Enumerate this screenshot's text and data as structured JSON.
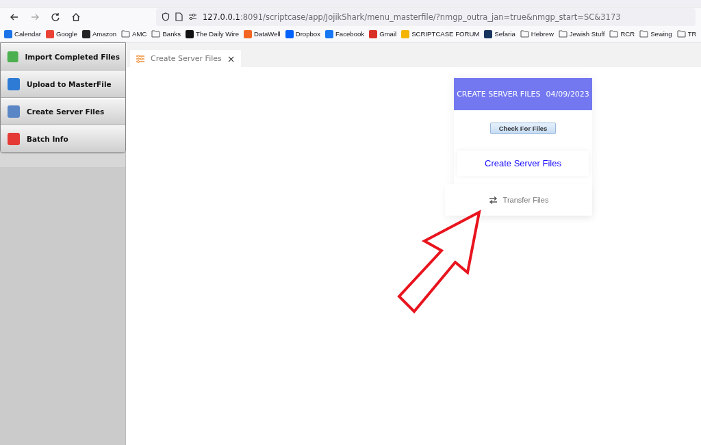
{
  "browser": {
    "url_host": "127.0.0.1",
    "url_rest": ":8091/scriptcase/app/JojikShark/menu_masterfile/?nmgp_outra_jan=true&nmgp_start=SC&3173",
    "bookmarks": [
      {
        "label": "Calendar",
        "kind": "site",
        "color": "#1a73e8"
      },
      {
        "label": "Google",
        "kind": "site",
        "color": "#ea4335"
      },
      {
        "label": "Amazon",
        "kind": "site",
        "color": "#222222"
      },
      {
        "label": "AMC",
        "kind": "folder"
      },
      {
        "label": "Banks",
        "kind": "folder"
      },
      {
        "label": "The Daily Wire",
        "kind": "site",
        "color": "#111111"
      },
      {
        "label": "DataWell",
        "kind": "site",
        "color": "#f26522"
      },
      {
        "label": "Dropbox",
        "kind": "site",
        "color": "#0061fe"
      },
      {
        "label": "Facebook",
        "kind": "site",
        "color": "#1877f2"
      },
      {
        "label": "Gmail",
        "kind": "site",
        "color": "#d93025"
      },
      {
        "label": "SCRIPTCASE FORUM",
        "kind": "site",
        "color": "#f4b400"
      },
      {
        "label": "Sefaria",
        "kind": "site",
        "color": "#18345d"
      },
      {
        "label": "Hebrew",
        "kind": "folder"
      },
      {
        "label": "Jewish Stuff",
        "kind": "folder"
      },
      {
        "label": "RCR",
        "kind": "folder"
      },
      {
        "label": "Sewing",
        "kind": "folder"
      },
      {
        "label": "TR",
        "kind": "folder"
      }
    ]
  },
  "menu": [
    {
      "label": "Import Completed Files",
      "color": "#4caf50"
    },
    {
      "label": "Upload to MasterFile",
      "color": "#2e7bd6"
    },
    {
      "label": "Create Server Files",
      "color": "#5b86c5"
    },
    {
      "label": "Batch Info",
      "color": "#e53935"
    }
  ],
  "tab": {
    "label": "Create Server Files",
    "close": "×"
  },
  "card": {
    "title": "CREATE SERVER FILES",
    "date": "04/09/2023",
    "button": "Check For Files",
    "link": "Create Server Files",
    "transfer": "Transfer Files"
  }
}
